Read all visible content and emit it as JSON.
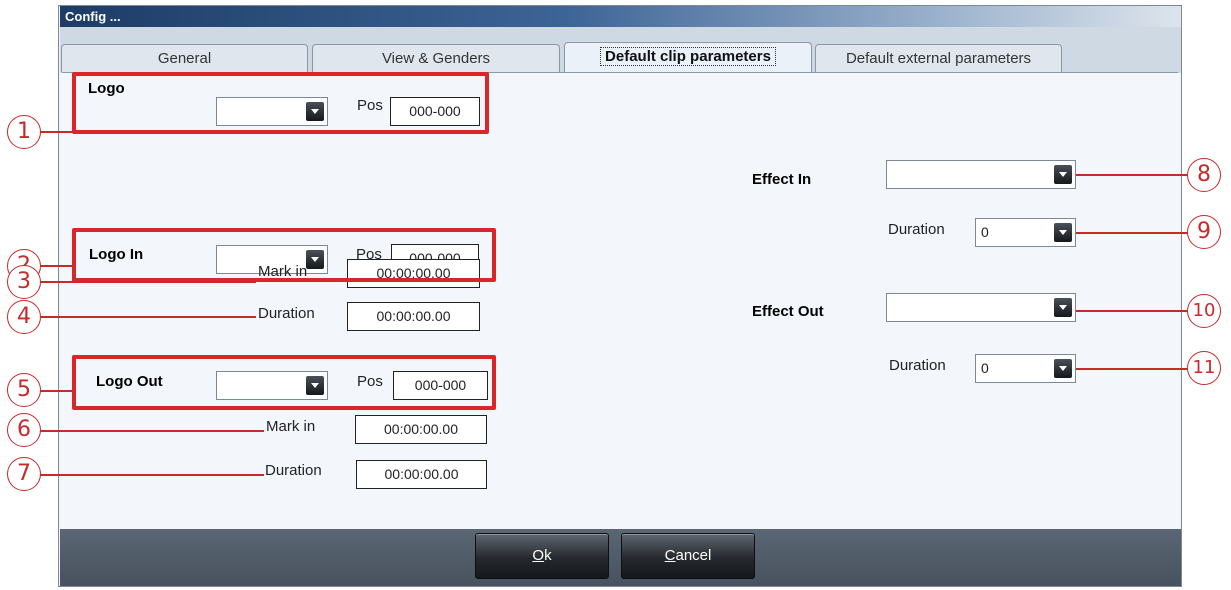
{
  "window": {
    "title": "Config ..."
  },
  "tabs": [
    {
      "label": "General"
    },
    {
      "label": "View & Genders"
    },
    {
      "label": "Default clip parameters"
    },
    {
      "label": "Default external parameters"
    }
  ],
  "logo": {
    "title": "Logo",
    "combo_value": "",
    "pos_label": "Pos",
    "pos_value": "000-000"
  },
  "logo_in": {
    "title": "Logo In",
    "combo_value": "",
    "pos_label": "Pos",
    "pos_value": "000-000",
    "mark_in_label": "Mark in",
    "mark_in_value": "00:00:00.00",
    "duration_label": "Duration",
    "duration_value": "00:00:00.00"
  },
  "logo_out": {
    "title": "Logo Out",
    "combo_value": "",
    "pos_label": "Pos",
    "pos_value": "000-000",
    "mark_in_label": "Mark in",
    "mark_in_value": "00:00:00.00",
    "duration_label": "Duration",
    "duration_value": "00:00:00.00"
  },
  "effect_in": {
    "title": "Effect In",
    "combo_value": "",
    "duration_label": "Duration",
    "duration_value": "0"
  },
  "effect_out": {
    "title": "Effect Out",
    "combo_value": "",
    "duration_label": "Duration",
    "duration_value": "0"
  },
  "buttons": {
    "ok_label": "k",
    "ok_mnemonic": "O",
    "cancel_label": "ancel",
    "cancel_mnemonic": "C"
  },
  "callouts": [
    "1",
    "2",
    "3",
    "4",
    "5",
    "6",
    "7",
    "8",
    "9",
    "10",
    "11"
  ],
  "colors": {
    "callout_red": "#d9262a",
    "title_bar_dark": "#1d3c66",
    "button_dark": "#25292e"
  }
}
